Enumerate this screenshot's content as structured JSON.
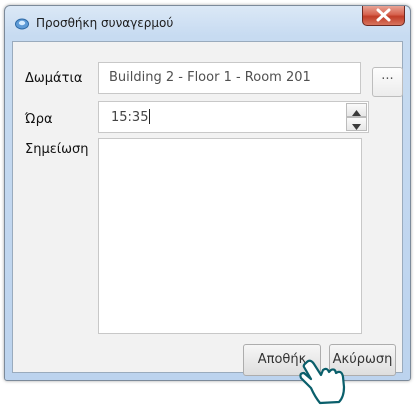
{
  "window": {
    "title": "Προσθήκη συναγερμού",
    "close_symbol": "x"
  },
  "form": {
    "room_label": "Δωμάτια",
    "room_value": "Building 2 - Floor 1 - Room 201",
    "browse_label": "···",
    "time_label": "Ώρα",
    "time_value": "15:35",
    "note_label": "Σημείωση",
    "note_value": ""
  },
  "buttons": {
    "save": "Αποθήκ",
    "cancel": "Ακύρωση"
  },
  "icons": {
    "app": "bell-icon",
    "close": "close-icon",
    "spin_up": "arrow-up-icon",
    "spin_down": "arrow-down-icon",
    "pointer": "hand-pointer-icon"
  }
}
